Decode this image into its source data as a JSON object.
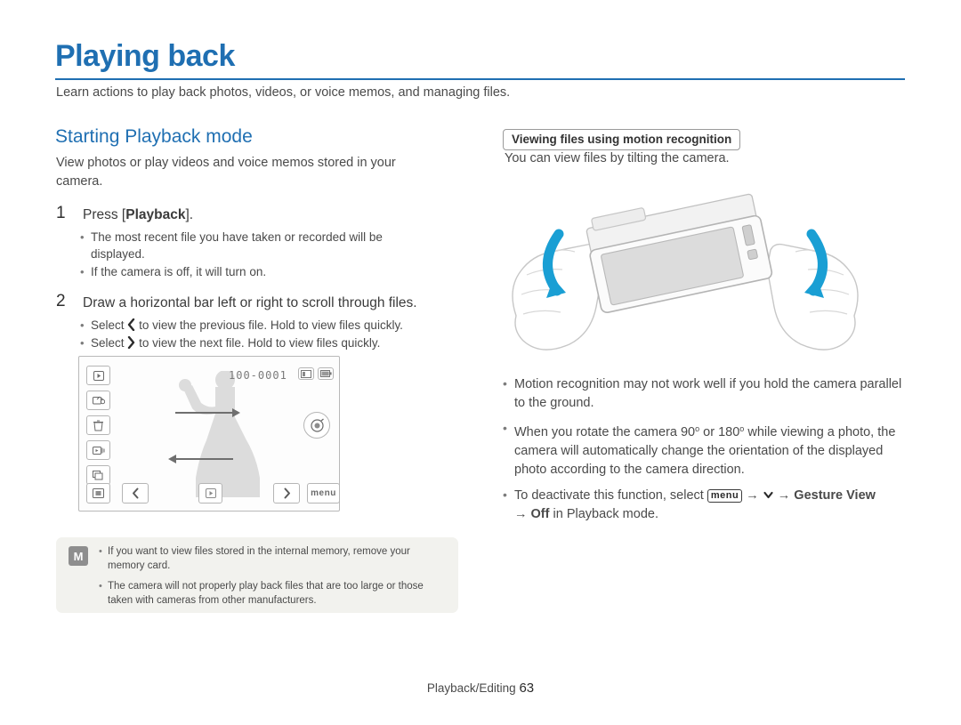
{
  "header": {
    "title": "Playing back",
    "subtitle": "Learn actions to play back photos, videos, or voice memos, and managing files."
  },
  "left": {
    "section_title": "Starting Playback mode",
    "intro": "View photos or play videos and voice memos stored in your camera.",
    "step1": {
      "num": "1",
      "text_before": "Press [",
      "text_bold": "Playback",
      "text_after": "].",
      "bullets": [
        "The most recent file you have taken or recorded will be displayed.",
        "If the camera is off, it will turn on."
      ]
    },
    "step2": {
      "num": "2",
      "text": "Draw a horizontal bar left or right to scroll through files.",
      "bullet1_before": "Select",
      "bullet1_after": "to view the previous file. Hold to view files quickly.",
      "bullet2_before": "Select",
      "bullet2_after": "to view the next file. Hold to view files quickly."
    },
    "screen": {
      "file_number": "100-0001",
      "left_icons": [
        "play-icon",
        "protect-icon",
        "delete-icon",
        "slideshow-icon",
        "thumbnail-icon"
      ],
      "bottom_icons": [
        "display-icon",
        "prev-arrow-icon",
        "play-small-icon",
        "next-arrow-icon",
        "menu-icon"
      ],
      "menu_label": "menu",
      "right_icon": "smart-filter-icon"
    },
    "note": {
      "icon_label": "M",
      "items": [
        "If you want to view files stored in the internal memory, remove your memory card.",
        "The camera will not properly play back files that are too large or those taken with cameras from other manufacturers."
      ]
    }
  },
  "right": {
    "tag": "Viewing files using motion recognition",
    "tag_sub": "You can view files by tilting the camera.",
    "bullets": [
      "Motion recognition may not work well if you hold the camera parallel to the ground.",
      "When you rotate the camera 90º or 180º while viewing a photo, the camera will automatically change the orientation of the displayed photo according to the camera direction."
    ],
    "bullet3": {
      "before": "To deactivate this function, select",
      "menu_glyph": "menu",
      "arrow": "→",
      "bold": "Gesture View",
      "arrow2": "→",
      "off": "Off",
      "after": "in Playback mode."
    }
  },
  "footer": {
    "label": "Playback/Editing",
    "page": "63"
  },
  "colors": {
    "accent": "#1f6fb2",
    "text": "#3b3b3b",
    "note_bg": "#f2f2ee"
  }
}
